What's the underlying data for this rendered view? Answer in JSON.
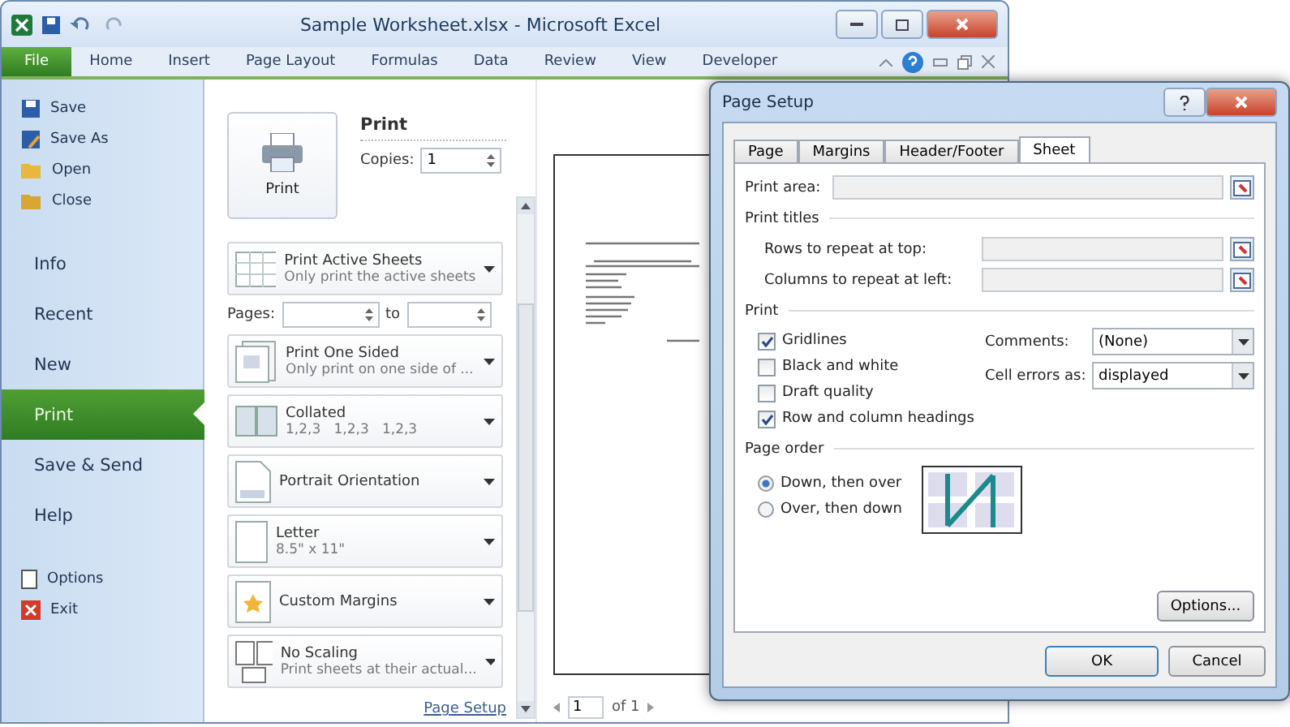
{
  "window": {
    "title": "Sample Worksheet.xlsx - Microsoft Excel"
  },
  "ribbon_tabs": [
    {
      "label": "File",
      "selected": true
    },
    {
      "label": "Home",
      "selected": false
    },
    {
      "label": "Insert",
      "selected": false
    },
    {
      "label": "Page Layout",
      "selected": false
    },
    {
      "label": "Formulas",
      "selected": false
    },
    {
      "label": "Data",
      "selected": false
    },
    {
      "label": "Review",
      "selected": false
    },
    {
      "label": "View",
      "selected": false
    },
    {
      "label": "Developer",
      "selected": false
    }
  ],
  "nav": [
    {
      "label": "Save",
      "kind": "command",
      "selected": false
    },
    {
      "label": "Save As",
      "kind": "command",
      "selected": false
    },
    {
      "label": "Open",
      "kind": "command",
      "selected": false
    },
    {
      "label": "Close",
      "kind": "command",
      "selected": false
    },
    {
      "label": "Info",
      "kind": "page",
      "selected": false
    },
    {
      "label": "Recent",
      "kind": "page",
      "selected": false
    },
    {
      "label": "New",
      "kind": "page",
      "selected": false
    },
    {
      "label": "Print",
      "kind": "page",
      "selected": true
    },
    {
      "label": "Save & Send",
      "kind": "page",
      "selected": false
    },
    {
      "label": "Help",
      "kind": "page",
      "selected": false
    },
    {
      "label": "Options",
      "kind": "command",
      "selected": false
    },
    {
      "label": "Exit",
      "kind": "command",
      "selected": false
    }
  ],
  "print_panel": {
    "heading": "Print",
    "button": "Print",
    "copies_label": "Copies:",
    "copies_value": "1",
    "settings": [
      {
        "kind": "dropdown",
        "title": "Print Active Sheets",
        "subtitle": "Only print the active sheets"
      },
      {
        "kind": "pages",
        "label": "Pages:",
        "to": "to"
      },
      {
        "kind": "dropdown",
        "title": "Print One Sided",
        "subtitle": "Only print on one side of ..."
      },
      {
        "kind": "dropdown",
        "title": "Collated",
        "subtitle": "1,2,3   1,2,3   1,2,3"
      },
      {
        "kind": "dropdown",
        "title": "Portrait Orientation"
      },
      {
        "kind": "dropdown",
        "title": "Letter",
        "subtitle": "8.5\" x 11\""
      },
      {
        "kind": "dropdown",
        "title": "Custom Margins"
      },
      {
        "kind": "dropdown",
        "title": "No Scaling",
        "subtitle": "Print sheets at their actual..."
      }
    ],
    "page_setup_link": "Page Setup"
  },
  "preview": {
    "page_value": "1",
    "page_total": "of 1"
  },
  "dialog": {
    "title": "Page Setup",
    "tabs": [
      {
        "label": "Page",
        "selected": false
      },
      {
        "label": "Margins",
        "selected": false
      },
      {
        "label": "Header/Footer",
        "selected": false
      },
      {
        "label": "Sheet",
        "selected": true
      }
    ],
    "print_area_label": "Print area:",
    "print_titles_label": "Print titles",
    "rows_label": "Rows to repeat at top:",
    "columns_label": "Columns to repeat at left:",
    "print_label": "Print",
    "checkboxes": [
      {
        "label": "Gridlines",
        "checked": true
      },
      {
        "label": "Black and white",
        "checked": false
      },
      {
        "label": "Draft quality",
        "checked": false
      },
      {
        "label": "Row and column headings",
        "checked": true
      }
    ],
    "comments_label": "Comments:",
    "comments_value": "(None)",
    "cell_errors_label": "Cell errors as:",
    "cell_errors_value": "displayed",
    "page_order_label": "Page order",
    "radios": [
      {
        "label": "Down, then over",
        "selected": true
      },
      {
        "label": "Over, then down",
        "selected": false
      }
    ],
    "options_button": "Options...",
    "ok_button": "OK",
    "cancel_button": "Cancel"
  }
}
